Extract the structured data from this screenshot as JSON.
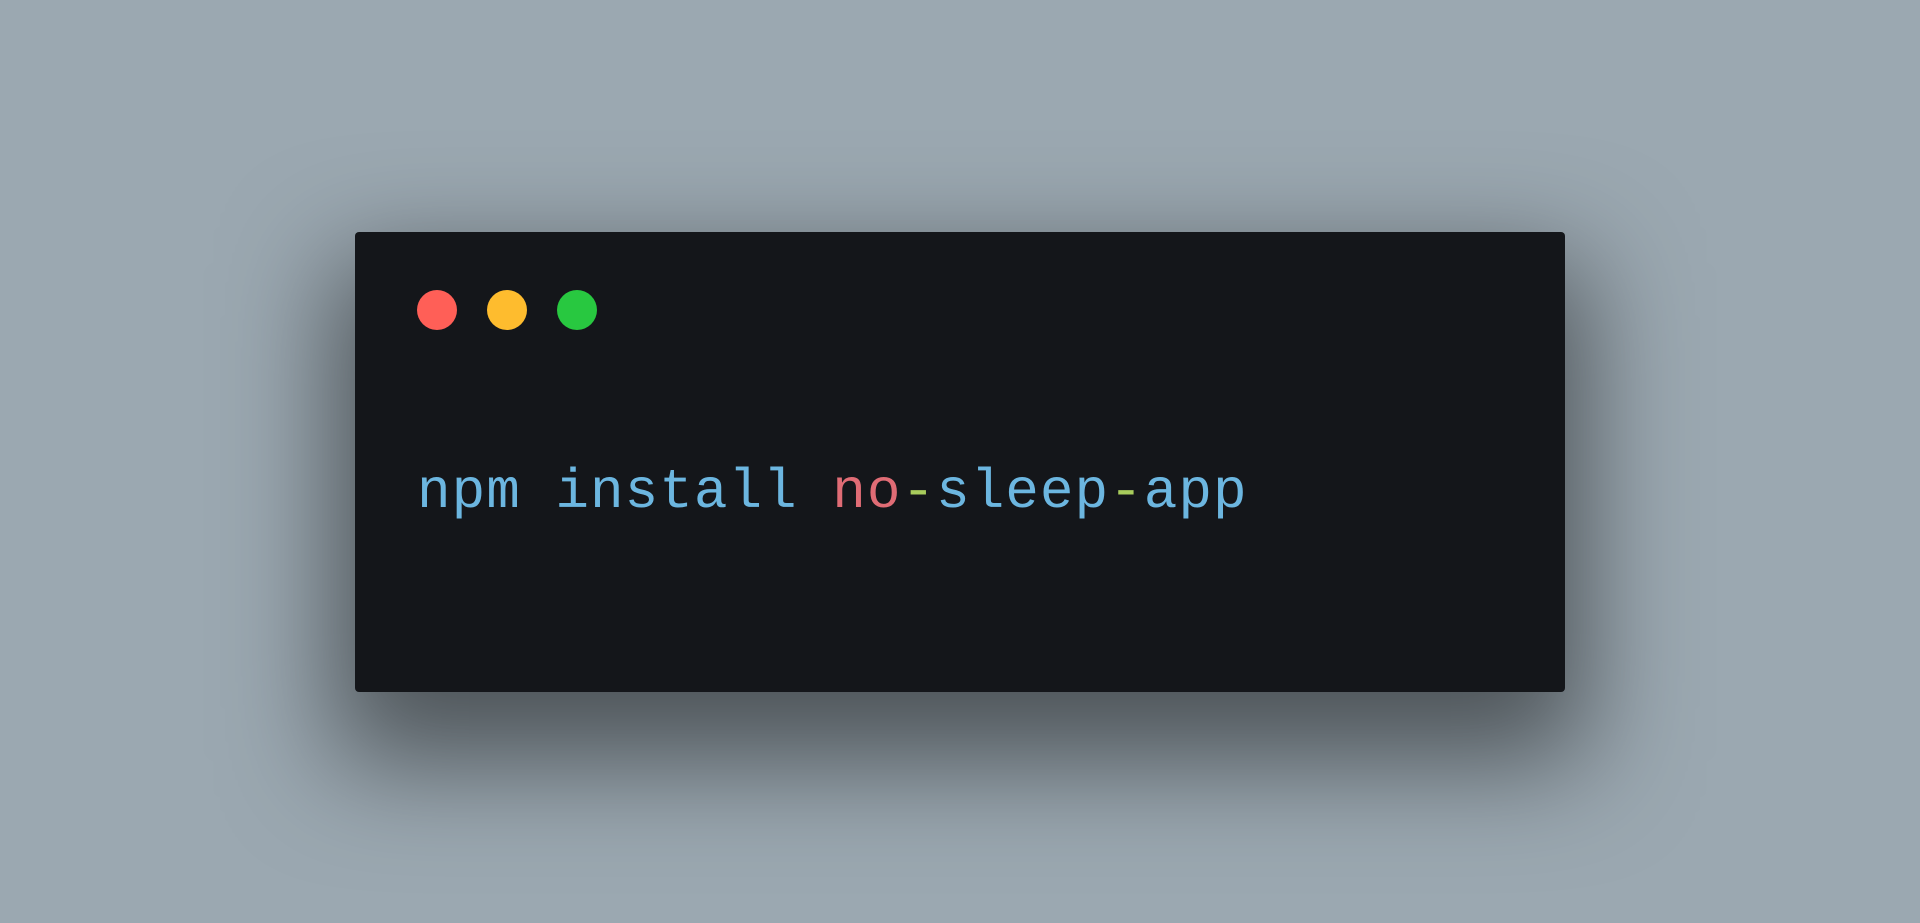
{
  "terminal": {
    "command": {
      "part1": "npm install ",
      "keyword": "no",
      "dash1": "-",
      "part2": "sleep",
      "dash2": "-",
      "part3": "app"
    }
  },
  "traffic_lights": {
    "close_color": "#ff5f57",
    "minimize_color": "#febc2e",
    "maximize_color": "#28c840"
  }
}
